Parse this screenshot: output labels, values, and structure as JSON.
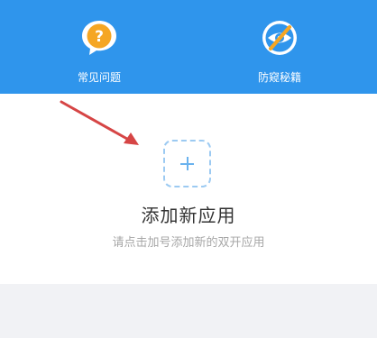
{
  "toolbar": {
    "items": [
      {
        "label": "常见问题",
        "icon": "question-bubble-icon"
      },
      {
        "label": "防窥秘籍",
        "icon": "shield-eye-icon"
      }
    ]
  },
  "main": {
    "add_button_icon": "plus-icon",
    "title": "添加新应用",
    "hint": "请点击加号添加新的双开应用"
  },
  "colors": {
    "header_bg": "#2f95ec",
    "question_icon": "#f5a623",
    "dashed_border": "#9ccaf2",
    "annotation_arrow": "#d64545",
    "bottom_bg": "#f1f2f5"
  }
}
